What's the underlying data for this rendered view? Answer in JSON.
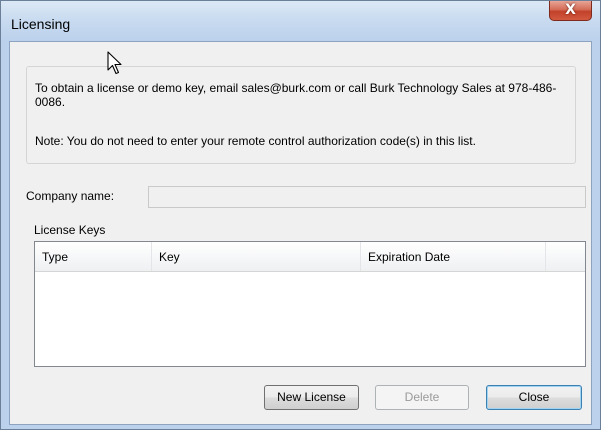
{
  "window": {
    "title": "Licensing",
    "close_glyph": "X"
  },
  "info": {
    "line1": "To obtain a license or demo key, email sales@burk.com or call Burk Technology Sales at 978-486-0086.",
    "note": "Note: You do not need to enter your remote control authorization code(s) in this list."
  },
  "company": {
    "label": "Company name:",
    "value": ""
  },
  "license_keys": {
    "label": "License Keys",
    "columns": [
      "Type",
      "Key",
      "Expiration Date"
    ],
    "rows": []
  },
  "buttons": {
    "new_license": "New License",
    "delete": "Delete",
    "close": "Close"
  },
  "icons": {
    "cursor": "arrow-cursor-icon",
    "close": "close-icon"
  }
}
